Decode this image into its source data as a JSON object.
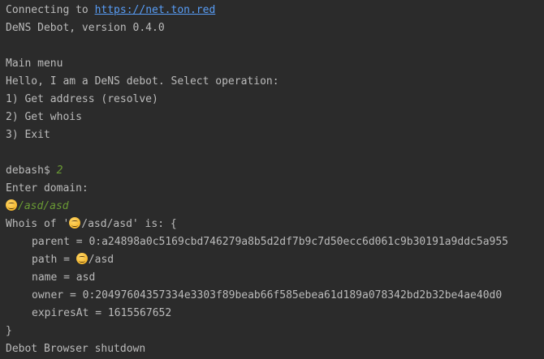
{
  "terminal": {
    "connect_prefix": "Connecting to ",
    "connect_url": "https://net.ton.red",
    "version_line": "DeNS Debot, version 0.4.0",
    "menu_title": "Main menu",
    "greeting": "Hello, I am a DeNS debot. Select operation:",
    "options": [
      "1) Get address (resolve)",
      "2) Get whois",
      "3) Exit"
    ],
    "prompt": "debash$ ",
    "prompt_input": "2",
    "enter_domain": "Enter domain:",
    "domain_input": "/asd/asd",
    "whois_prefix": "Whois of '",
    "whois_domain": "/asd/asd",
    "whois_suffix": "' is: {",
    "whois": {
      "parent": "parent = 0:a24898a0c5169cbd746279a8b5d2df7b9c7d50ecc6d061c9b30191a9ddc5a955",
      "path_prefix": "path = ",
      "path_value": "/asd",
      "name": "name = asd",
      "owner": "owner = 0:20497604357334e3303f89beab66f585ebea61d189a078342bd2b32be4ae40d0",
      "expires": "expiresAt = 1615567652"
    },
    "close_brace": "}",
    "shutdown": "Debot Browser shutdown",
    "emoji_icon": "hugging-face-emoji"
  },
  "colors": {
    "background": "#2b2b2b",
    "text": "#bbbbbb",
    "link": "#589df6",
    "input": "#6a9a34"
  }
}
